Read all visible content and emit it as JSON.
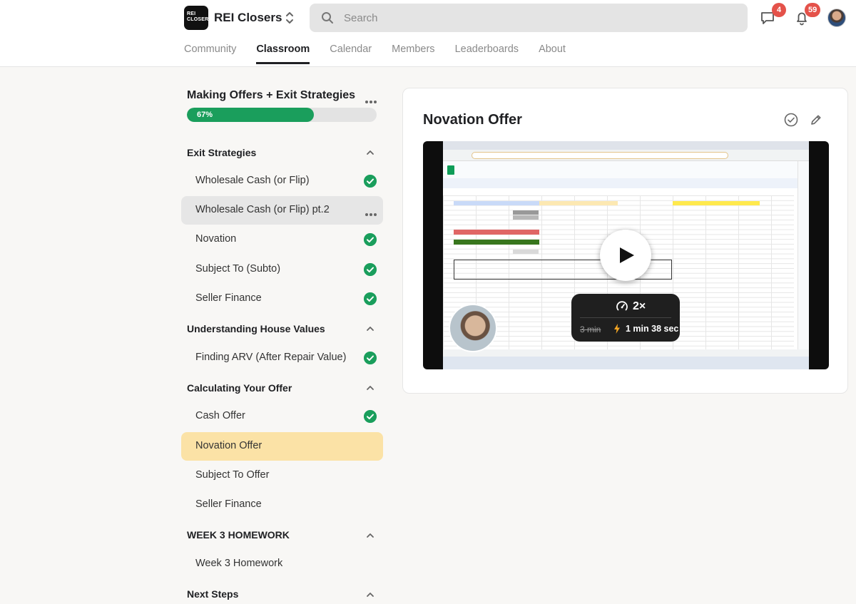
{
  "header": {
    "logo_text": "REI CLOSERS",
    "brand": "REI Closers",
    "search_placeholder": "Search",
    "chat_badge": "4",
    "notif_badge": "59",
    "nav": [
      "Community",
      "Classroom",
      "Calendar",
      "Members",
      "Leaderboards",
      "About"
    ],
    "nav_active": "Classroom"
  },
  "course": {
    "title": "Making Offers + Exit Strategies",
    "progress": 0.67,
    "progress_label": "67%"
  },
  "sidebar": {
    "sections": [
      {
        "title": "Exit Strategies",
        "lessons": [
          {
            "label": "Wholesale Cash (or Flip)",
            "completed": true
          },
          {
            "label": "Wholesale Cash (or Flip) pt.2",
            "completed": false
          },
          {
            "label": "Novation",
            "completed": true
          },
          {
            "label": "Subject To (Subto)",
            "completed": true
          },
          {
            "label": "Seller Finance",
            "completed": true
          }
        ]
      },
      {
        "title": "Understanding House Values",
        "lessons": [
          {
            "label": "Finding ARV (After Repair Value)",
            "completed": true
          }
        ]
      },
      {
        "title": "Calculating Your Offer",
        "lessons": [
          {
            "label": "Cash Offer",
            "completed": true
          },
          {
            "label": "Novation Offer",
            "completed": false,
            "current": true
          },
          {
            "label": "Subject To Offer",
            "completed": false
          },
          {
            "label": "Seller Finance",
            "completed": false
          }
        ]
      },
      {
        "title": "WEEK 3 HOMEWORK",
        "lessons": [
          {
            "label": "Week 3 Homework",
            "completed": false
          }
        ]
      },
      {
        "title": "Next Steps",
        "lessons": []
      }
    ]
  },
  "lesson": {
    "title": "Novation Offer",
    "video": {
      "speed": "2×",
      "original_duration": "3 min",
      "new_duration": "1 min 38 sec"
    }
  },
  "colors": {
    "accent_green": "#1a9e5c",
    "current_lesson_bg": "#fbe2a6",
    "badge_red": "#e4524a"
  },
  "icons": [
    "search-icon",
    "chevron-updown-icon",
    "chat-icon",
    "bell-icon",
    "more-icon",
    "chevron-up-icon",
    "check-circle-icon",
    "mark-complete-icon",
    "edit-icon",
    "play-icon",
    "speed-icon",
    "lightning-icon"
  ]
}
